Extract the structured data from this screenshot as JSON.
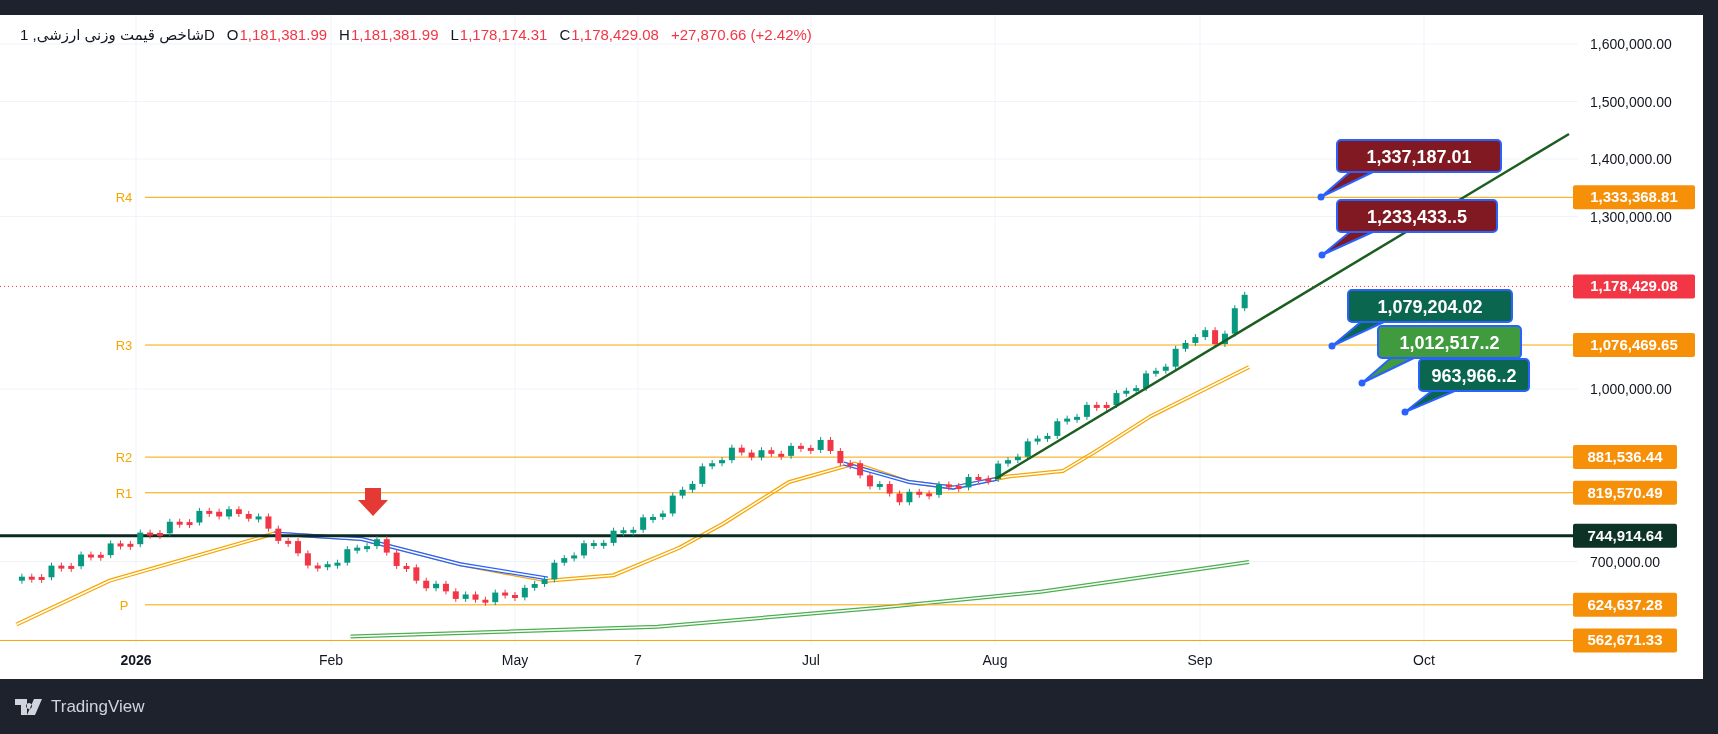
{
  "legend": {
    "symbol": "شاخص قیمت وزنی ارزشی, 1D",
    "values": [
      {
        "key": "O",
        "value": "1,181,381.99"
      },
      {
        "key": "H",
        "value": "1,181,381.99"
      },
      {
        "key": "L",
        "value": "1,178,174.31"
      },
      {
        "key": "C",
        "value": "1,178,429.08"
      }
    ],
    "change": "+27,870.66 (+2.42%)"
  },
  "price_axis": {
    "ticks": [
      "1,600,000.00",
      "1,500,000.00",
      "1,400,000.00",
      "1,300,000.00",
      "1,000,000.00",
      "700,000.00"
    ]
  },
  "time_axis": {
    "labels": [
      {
        "text": "2026",
        "kind": "year"
      },
      {
        "text": "Feb",
        "kind": "month"
      },
      {
        "text": "May",
        "kind": "month"
      },
      {
        "text": "7",
        "kind": "day"
      },
      {
        "text": "Jul",
        "kind": "month"
      },
      {
        "text": "Aug",
        "kind": "month"
      },
      {
        "text": "Sep",
        "kind": "month"
      },
      {
        "text": "Oct",
        "kind": "month"
      }
    ]
  },
  "levels": [
    {
      "label": "R4",
      "price": "1,333,368.81",
      "kind": "pivot"
    },
    {
      "price": "1,178,429.08",
      "kind": "last"
    },
    {
      "label": "R3",
      "price": "1,076,469.65",
      "kind": "pivot"
    },
    {
      "label": "R2",
      "price": "881,536.44",
      "kind": "pivot"
    },
    {
      "label": "R1",
      "price": "819,570.49",
      "kind": "pivot"
    },
    {
      "price": "744,914.64",
      "kind": "horizontal"
    },
    {
      "label": "P",
      "price": "624,637.28",
      "kind": "pivot"
    },
    {
      "price": "562,671.33",
      "kind": "pivot"
    }
  ],
  "callouts": [
    {
      "text": "1,337,187.01",
      "color": "#801922"
    },
    {
      "text": "1,233,433..5",
      "color": "#801922"
    },
    {
      "text": "1,079,204.02",
      "color": "#0b6650"
    },
    {
      "text": "1,012,517..2",
      "color": "#3f9b3d"
    },
    {
      "text": "963,966..2",
      "color": "#0b6650"
    }
  ],
  "footer": {
    "brand": "TradingView"
  }
}
